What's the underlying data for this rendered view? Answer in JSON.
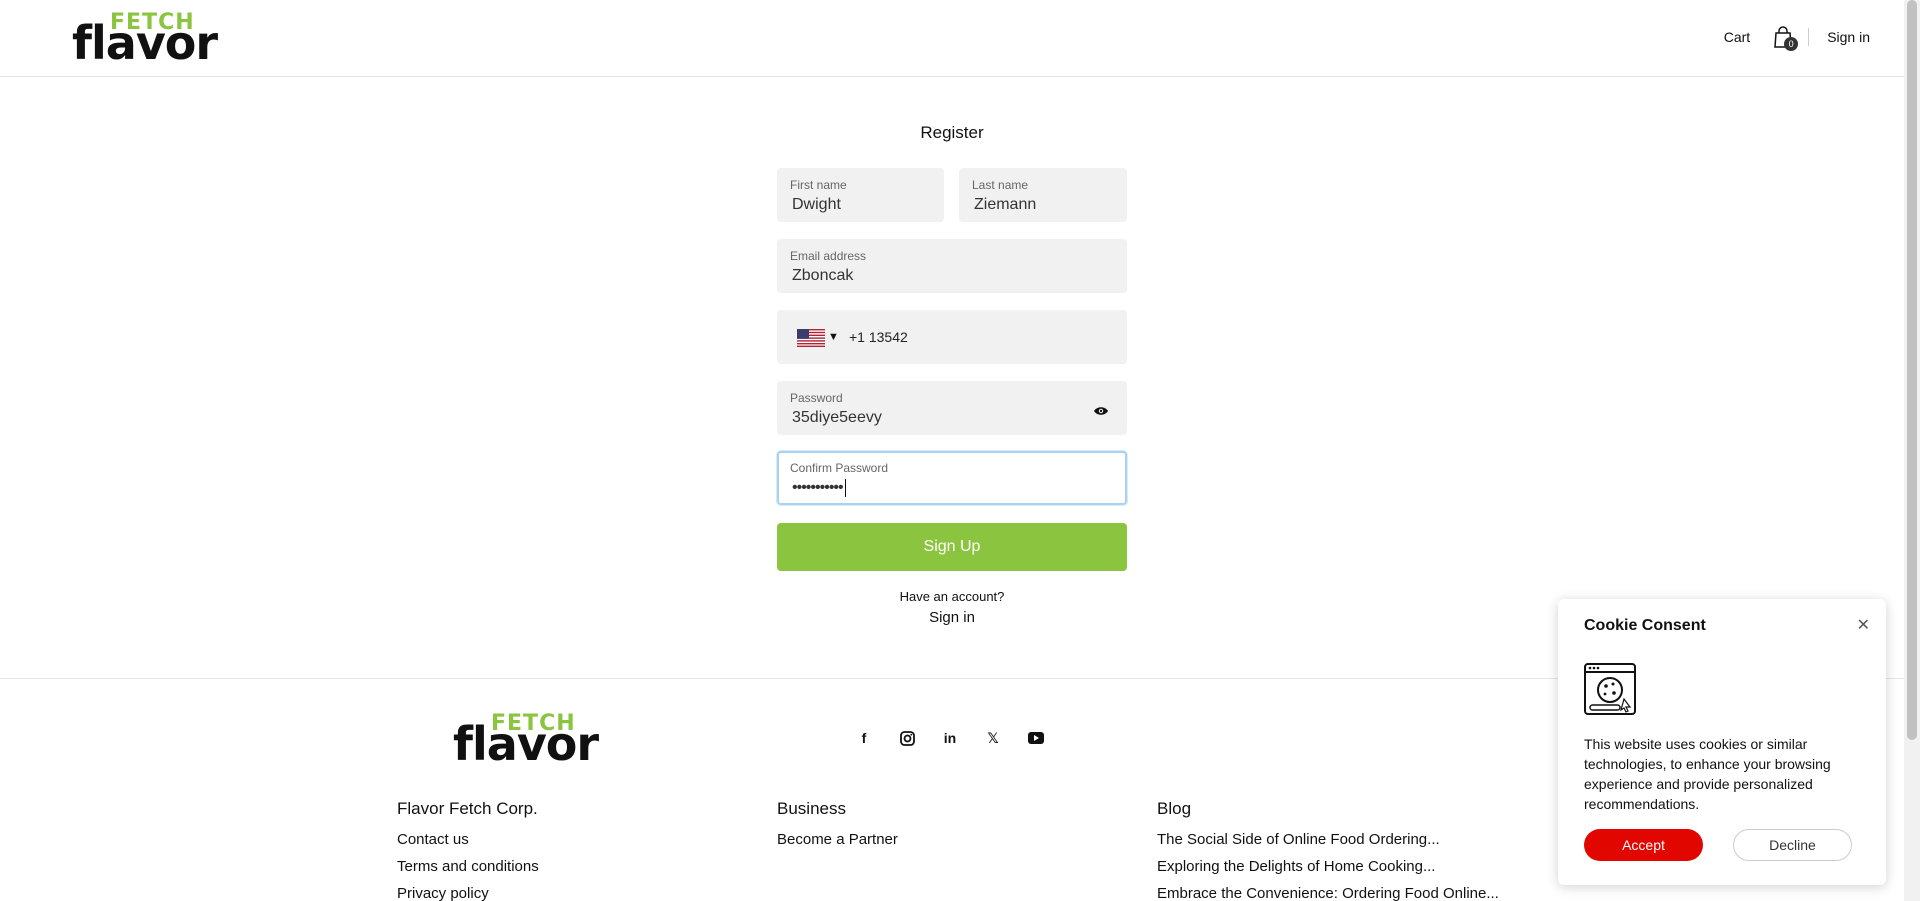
{
  "header": {
    "logo_top": "FETCH",
    "logo_bottom": "flavor",
    "cart_label": "Cart",
    "cart_count": "0",
    "signin_label": "Sign in"
  },
  "register": {
    "title": "Register",
    "first_name_label": "First name",
    "first_name_value": "Dwight",
    "last_name_label": "Last name",
    "last_name_value": "Ziemann",
    "email_label": "Email address",
    "email_value": "Zboncak",
    "phone_value": "+1 13542",
    "password_label": "Password",
    "password_value": "35diye5eevy",
    "confirm_label": "Confirm Password",
    "confirm_value": "•••••••••••",
    "signup_label": "Sign Up",
    "have_account": "Have an account?",
    "signin_label": "Sign in"
  },
  "footer": {
    "logo_top": "FETCH",
    "logo_bottom": "flavor",
    "social_icons": [
      "facebook-icon",
      "instagram-icon",
      "linkedin-icon",
      "x-icon",
      "youtube-icon"
    ],
    "columns": [
      {
        "heading": "Flavor Fetch Corp.",
        "links": [
          "Contact us",
          "Terms and conditions",
          "Privacy policy"
        ]
      },
      {
        "heading": "Business",
        "links": [
          "Become a Partner"
        ]
      },
      {
        "heading": "Blog",
        "links": [
          "The Social Side of Online Food Ordering...",
          "Exploring the Delights of Home Cooking...",
          "Embrace the Convenience: Ordering Food Online..."
        ]
      }
    ]
  },
  "cookie": {
    "title": "Cookie Consent",
    "text": "This website uses cookies or similar technologies, to enhance your browsing experience and provide personalized recommendations.",
    "accept_label": "Accept",
    "decline_label": "Decline"
  },
  "colors": {
    "brand_green": "#8bc43f",
    "accept_red": "#e10600",
    "focus_border": "#a8d4f0"
  }
}
